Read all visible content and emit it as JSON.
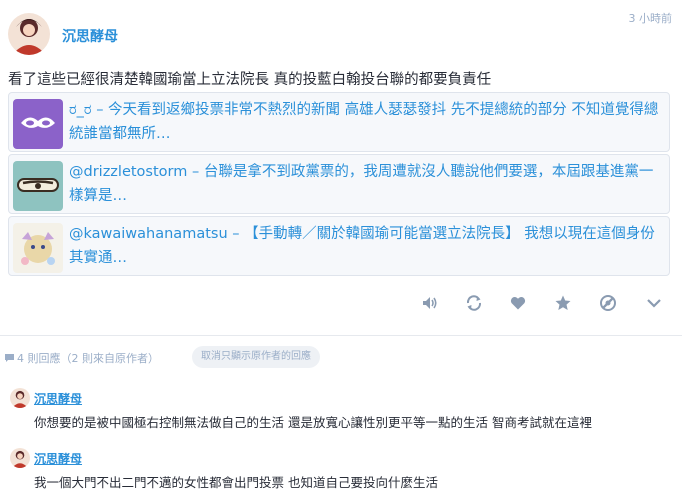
{
  "status": {
    "author": "沉思酵母",
    "time": "3 小時前",
    "content": "看了這些已經很清楚韓國瑜當上立法院長 真的投藍白翰投台聯的都要負責任",
    "cards": [
      {
        "text": "ರ_ರ – 今天看到返鄉投票非常不熱烈的新聞 高雄人瑟瑟發抖 先不提總統的部分 不知道覺得總統誰當都無所…"
      },
      {
        "text": "@drizzletostorm – 台聯是拿不到政黨票的，我周遭就沒人聽說他們要選，本屆跟基進黨一樣算是…"
      },
      {
        "text": "@kawaiwahanamatsu – 【手動轉／關於韓國瑜可能當選立法院長】 我想以現在這個身份其實通…"
      }
    ],
    "actions": [
      "speaker-icon",
      "boost-icon",
      "favourite-icon",
      "star-icon",
      "block-icon",
      "chevron-down-icon"
    ]
  },
  "thread": {
    "count_label": "4 則回應（2 則來自原作者）",
    "filter_label": "取消只顯示原作者的回應"
  },
  "replies": [
    {
      "author": "沉思酵母",
      "text": "你想要的是被中國極右控制無法做自己的生活 還是放寬心讓性別更平等一點的生活 智商考試就在這裡"
    },
    {
      "author": "沉思酵母",
      "text": "我一個大門不出二門不邁的女性都會出門投票 也知道自己要投向什麼生活"
    }
  ],
  "colors": {
    "accent": "#2b90d9",
    "muted": "#9baec8",
    "card_bg": "#f6f8fb"
  }
}
